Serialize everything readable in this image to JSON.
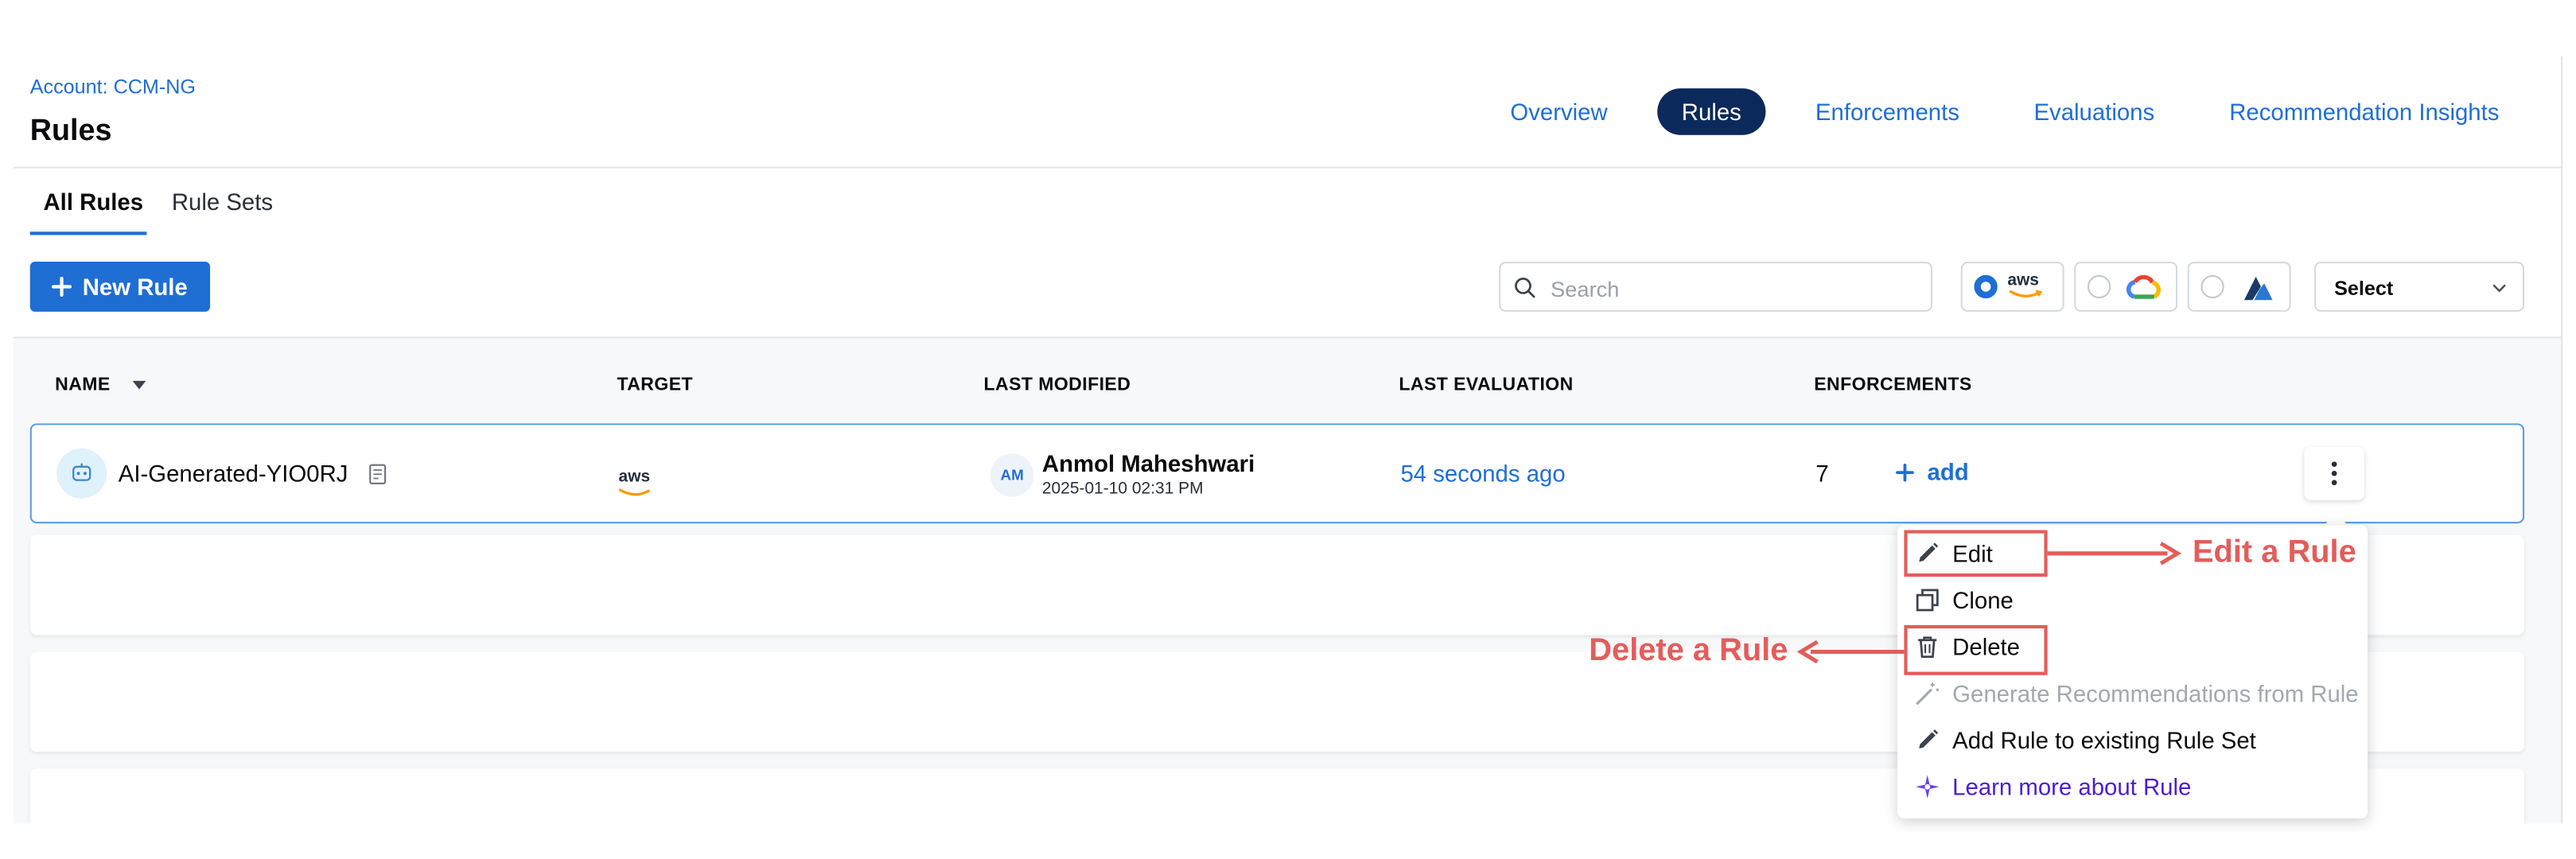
{
  "header": {
    "breadcrumb": "Account: CCM-NG",
    "title": "Rules",
    "tabs": [
      {
        "label": "Overview"
      },
      {
        "label": "Rules"
      },
      {
        "label": "Enforcements"
      },
      {
        "label": "Evaluations"
      },
      {
        "label": "Recommendation Insights"
      }
    ]
  },
  "subtabs": [
    {
      "label": "All Rules"
    },
    {
      "label": "Rule Sets"
    }
  ],
  "toolbar": {
    "new_rule_label": "New Rule",
    "search_placeholder": "Search",
    "clouds": [
      {
        "name": "aws",
        "label": "aws",
        "selected": true
      },
      {
        "name": "gcp",
        "selected": false
      },
      {
        "name": "azure",
        "selected": false
      }
    ],
    "select_value": "Select"
  },
  "table": {
    "columns": [
      "NAME",
      "TARGET",
      "LAST MODIFIED",
      "LAST EVALUATION",
      "ENFORCEMENTS"
    ],
    "rows": [
      {
        "name": "AI-Generated-YIO0RJ",
        "target": "aws",
        "modifier_initials": "AM",
        "modifier_name": "Anmol Maheshwari",
        "modified_time": "2025-01-10 02:31 PM",
        "last_evaluation": "54 seconds ago",
        "enforcements": "7",
        "add_label": "add"
      }
    ]
  },
  "context_menu": {
    "items": [
      {
        "label": "Edit",
        "icon": "pencil-icon"
      },
      {
        "label": "Clone",
        "icon": "clone-icon"
      },
      {
        "label": "Delete",
        "icon": "trash-icon"
      },
      {
        "label": "Generate Recommendations from Rule",
        "icon": "magic-wand-icon",
        "disabled": true
      },
      {
        "label": "Add Rule to existing Rule Set",
        "icon": "pencil-icon"
      },
      {
        "label": "Learn more about Rule",
        "icon": "sparkle-icon"
      }
    ]
  },
  "annotations": {
    "edit_label": "Edit a  Rule",
    "delete_label": "Delete a Rule",
    "color": "#e35d5b"
  },
  "colors": {
    "accent": "#1f6ed4",
    "active_tab": "#0b2a5b",
    "learn_more": "#4c1dd6"
  }
}
